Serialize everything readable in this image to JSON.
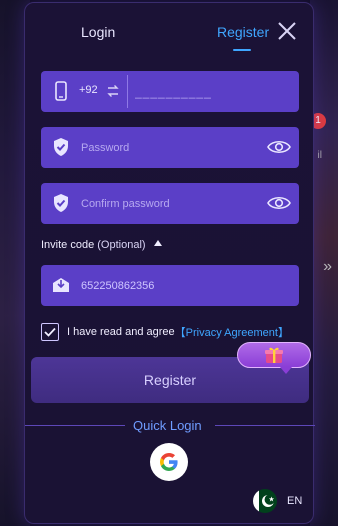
{
  "tabs": {
    "login": "Login",
    "register": "Register"
  },
  "phone": {
    "prefix": "+92",
    "placeholder": "__________"
  },
  "password": {
    "placeholder": "Password"
  },
  "confirm_password": {
    "placeholder": "Confirm password"
  },
  "invite": {
    "label": "Invite code",
    "optional": "(Optional)",
    "value": "652250862356"
  },
  "agreement": {
    "text": "I have read and agree",
    "link": "【Privacy Agreement】",
    "checked": true
  },
  "register_button": "Register",
  "quick_login": {
    "title": "Quick Login",
    "provider_icon": "google-icon"
  },
  "language": {
    "code": "EN",
    "flag_icon": "pakistan-flag-icon"
  },
  "background": {
    "badge_count": "1",
    "side_text": "il"
  },
  "colors": {
    "accent": "#3fa6ff",
    "field": "#5b3fc7",
    "panel": "#1b1236",
    "button": "#4d3697"
  }
}
